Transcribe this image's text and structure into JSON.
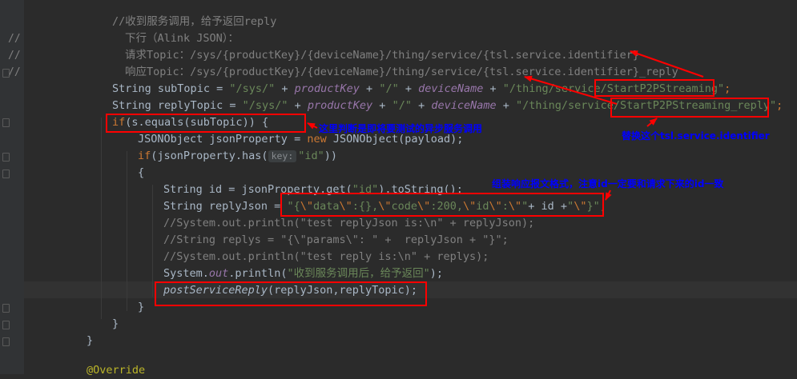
{
  "gutter": {
    "comment_mark": "//"
  },
  "code": {
    "l1": "//收到服务调用，给予返回reply",
    "l2": "下行（Alink JSON）：",
    "l3": "请求Topic：/sys/{productKey}/{deviceName}/thing/service/{tsl.service.identifier}",
    "l4": "响应Topic：/sys/{productKey}/{deviceName}/thing/service/{tsl.service.identifier}_reply",
    "l5": {
      "type": "String",
      "var": "subTopic",
      "s1": "\"/sys/\"",
      "f1": "productKey",
      "s2": "\"/\"",
      "f2": "deviceName",
      "s3": "\"/thing/service/StartP2PStreaming\""
    },
    "l6": {
      "type": "String",
      "var": "replyTopic",
      "s1": "\"/sys/\"",
      "f1": "productKey",
      "s2": "\"/\"",
      "f2": "deviceName",
      "s3": "\"/thing/service/StartP2PStreaming_reply\""
    },
    "l7": {
      "kw": "if",
      "rest": "(s.equals(subTopic)) {"
    },
    "l8": {
      "a": "JSONObject jsonProperty = ",
      "kw": "new",
      "b": " JSONObject(payload);"
    },
    "l9": {
      "kw": "if",
      "a": "(jsonProperty.has(",
      "hint": "key:",
      "s": "\"id\"",
      "b": "))"
    },
    "l10": "{",
    "l11": {
      "a": "String id = jsonProperty.get(",
      "s": "\"id\"",
      "b": ").toString();"
    },
    "l12": {
      "a": "String replyJson = ",
      "s1": "\"{",
      "e1": "\\\"",
      "s2": "data",
      "e2": "\\\"",
      "s3": ":{},",
      "e3": "\\\"",
      "s4": "code",
      "e4": "\\\"",
      "s5": ":200,",
      "e5": "\\\"",
      "s6": "id",
      "e6": "\\\"",
      "s7": ":",
      "e7": "\\\"",
      "s8": "\"",
      "b": "+ id +",
      "s9": "\"",
      "e8": "\\\"",
      "s10": "}\"",
      "end": ";"
    },
    "l13": "//System.out.println(\"test replyJson is:\\n\" + replyJson);",
    "l14": "//String replys = \"{\\\"params\\\": \" +  replyJson + \"}\";",
    "l15": "//System.out.println(\"test reply is:\\n\" + replys);",
    "l16": {
      "a": "System.",
      "out": "out",
      "b": ".println(",
      "s": "\"收到服务调用后，给予返回\"",
      "c": ");"
    },
    "l17": {
      "method": "postServiceReply",
      "rest": "(replyJson,replyTopic);"
    },
    "l18": "}",
    "l19": "}",
    "l20": "}",
    "l21": "@Override"
  },
  "annotations": {
    "note1": "这里判断是即将要测试的异步服务调用",
    "note2": "替换这个tsl.service.identifier",
    "note3": "组装响应报文格式，注意id一定要和请求下来的id一致"
  },
  "colors": {
    "annotation_box": "#ff0000",
    "annotation_text": "#0000ff",
    "background": "#2b2b2b"
  }
}
